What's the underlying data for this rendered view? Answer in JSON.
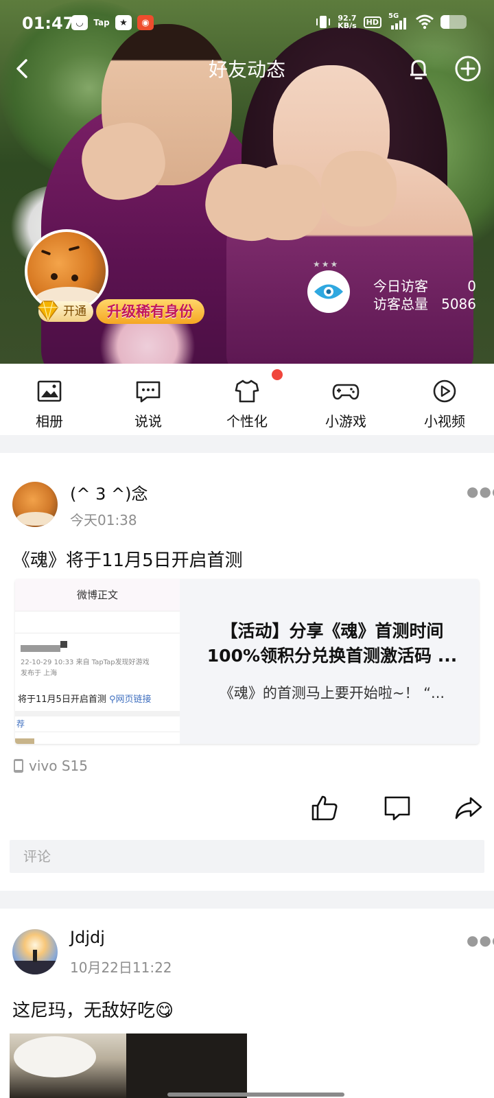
{
  "status_bar": {
    "time": "01:47",
    "tap_label": "Tap",
    "net_speed_value": "92.7",
    "net_speed_unit": "KB/s",
    "hd": "HD",
    "signal": "5G"
  },
  "header": {
    "title": "好友动态",
    "back_icon": "chevron-left-icon",
    "bell_icon": "bell-icon",
    "add_icon": "plus-circle-icon"
  },
  "profile": {
    "vip_open_label": "开通",
    "vip_upgrade_label": "升级稀有身份",
    "visitors_today_label": "今日访客",
    "visitors_today_value": "0",
    "visitors_total_label": "访客总量",
    "visitors_total_value": "5086"
  },
  "quick_menu": [
    {
      "label": "相册",
      "icon": "album-icon"
    },
    {
      "label": "说说",
      "icon": "chat-bubble-icon"
    },
    {
      "label": "个性化",
      "icon": "tshirt-icon",
      "has_badge": true
    },
    {
      "label": "小游戏",
      "icon": "gamepad-icon"
    },
    {
      "label": "小视频",
      "icon": "play-circle-icon"
    }
  ],
  "posts": [
    {
      "author": "(^ 3 ^)念",
      "time": "今天01:38",
      "text": "《魂》将于11月5日开启首测",
      "share_card": {
        "thumb_header": "微博正文",
        "thumb_meta_line1": "22-10-29 10:33  来自 TapTap发现好游戏",
        "thumb_meta_line2": "发布于 上海",
        "thumb_body": "将于11月5日开启首测",
        "thumb_link": "网页链接",
        "thumb_footer": "荐",
        "title": "【活动】分享《魂》首测时间100%领积分兑换首测激活码 ...",
        "description": "《魂》的首测马上要开始啦~！  “..."
      },
      "device": "vivo S15",
      "comment_placeholder": "评论"
    },
    {
      "author": "Jdjdj",
      "time": "10月22日11:22",
      "text": "这尼玛，无敌好吃😋"
    }
  ],
  "colors": {
    "accent_red": "#f0463c",
    "vip_gold": "#f5a623",
    "eye_blue": "#2fa8e0",
    "link_blue": "#3f6fbf"
  }
}
